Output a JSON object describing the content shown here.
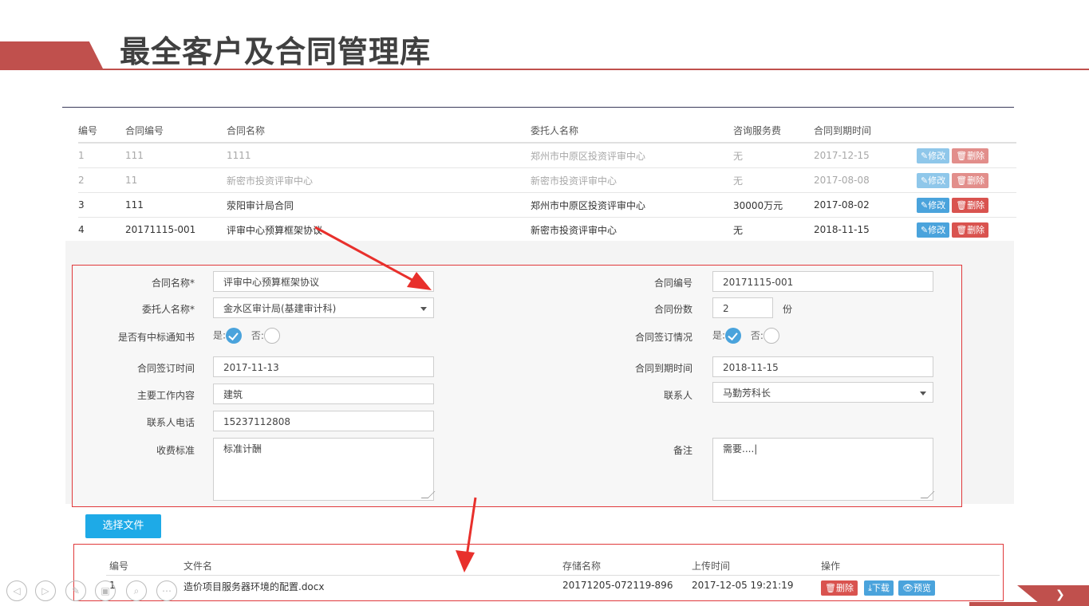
{
  "page_title": "最全客户及合同管理库",
  "list": {
    "headers": [
      "编号",
      "合同编号",
      "合同名称",
      "委托人名称",
      "咨询服务费",
      "合同到期时间"
    ],
    "rows": [
      {
        "no": "1",
        "code": "111",
        "name": "1111",
        "client": "郑州市中原区投资评审中心",
        "fee": "无",
        "due": "2017-12-15"
      },
      {
        "no": "2",
        "code": "11",
        "name": "新密市投资评审中心",
        "client": "新密市投资评审中心",
        "fee": "无",
        "due": "2017-08-08"
      },
      {
        "no": "3",
        "code": "111",
        "name": "荥阳审计局合同",
        "client": "郑州市中原区投资评审中心",
        "fee": "30000万元",
        "due": "2017-08-02"
      },
      {
        "no": "4",
        "code": "20171115-001",
        "name": "评审中心预算框架协议",
        "client": "新密市投资评审中心",
        "fee": "无",
        "due": "2018-11-15"
      }
    ],
    "edit_label": "修改",
    "delete_label": "删除"
  },
  "form": {
    "contract_name_label": "合同名称*",
    "contract_name_value": "评审中心预算框架协议",
    "contract_code_label": "合同编号",
    "contract_code_value": "20171115-001",
    "client_label": "委托人名称*",
    "client_value": "金水区审计局(基建审计科)",
    "copies_label": "合同份数",
    "copies_value": "2",
    "copies_unit": "份",
    "notice_label": "是否有中标通知书",
    "signed_label": "合同签订情况",
    "yes_label": "是:",
    "no_label": "否:",
    "sign_date_label": "合同签订时间",
    "sign_date_value": "2017-11-13",
    "due_date_label": "合同到期时间",
    "due_date_value": "2018-11-15",
    "work_label": "主要工作内容",
    "work_value": "建筑",
    "contact_label": "联系人",
    "contact_value": "马勤芳科长",
    "phone_label": "联系人电话",
    "phone_value": "15237112808",
    "fee_std_label": "收费标准",
    "fee_std_value": "标准计酬",
    "remark_label": "备注",
    "remark_value": "需要....|"
  },
  "upload": {
    "choose_label": "选择文件",
    "headers": {
      "no": "编号",
      "file_name": "文件名",
      "storage": "存储名称",
      "time": "上传时间",
      "ops": "操作"
    },
    "row": {
      "no": "1",
      "file_name": "造价项目服务器环境的配置.docx",
      "storage": "20171205-072119-896",
      "time": "2017-12-05 19:21:19"
    },
    "delete_label": "删除",
    "download_label": "下载",
    "preview_label": "预览"
  },
  "colors": {
    "accent_red": "#c0504d",
    "edit_blue": "#4aa3dc",
    "delete_red": "#d9534f",
    "choose_blue": "#1eaae7",
    "box_border": "#e0393b"
  }
}
